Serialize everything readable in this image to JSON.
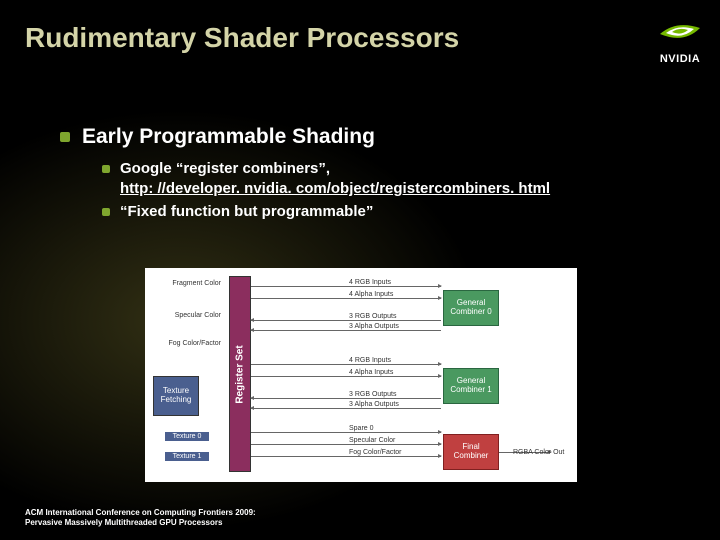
{
  "title": "Rudimentary Shader Processors",
  "logo": {
    "brand": "NVIDIA"
  },
  "bullets": {
    "l1": "Early Programmable Shading",
    "l2a_pre": "Google “register combiners”, ",
    "l2a_link": "http: //developer. nvidia. com/object/registercombiners. html",
    "l2b": "“Fixed function but programmable”"
  },
  "diagram": {
    "left_labels": {
      "frag_color": "Fragment Color",
      "spec_color": "Specular Color",
      "fog": "Fog Color/Factor",
      "tex0": "Texture 0",
      "tex1": "Texture 1"
    },
    "tex_fetch": "Texture Fetching",
    "reg_set": "Register Set",
    "mid_labels": {
      "rgb_in4": "4 RGB Inputs",
      "a_in4": "4 Alpha Inputs",
      "rgb_out3": "3 RGB Outputs",
      "a_out3": "3 Alpha Outputs",
      "rgb_in4b": "4 RGB Inputs",
      "a_in4b": "4 Alpha Inputs",
      "rgb_out3b": "3 RGB Outputs",
      "a_out3b": "3 Alpha Outputs",
      "spare0": "Spare 0",
      "spec": "Specular Color",
      "fog": "Fog Color/Factor"
    },
    "combiners": {
      "gc0": "General Combiner 0",
      "gc1": "General Combiner 1",
      "fc": "Final Combiner"
    },
    "out": "RGBA Color Out"
  },
  "footer": {
    "l1": "ACM International Conference on Computing Frontiers 2009:",
    "l2": "Pervasive Massively Multithreaded GPU Processors"
  }
}
